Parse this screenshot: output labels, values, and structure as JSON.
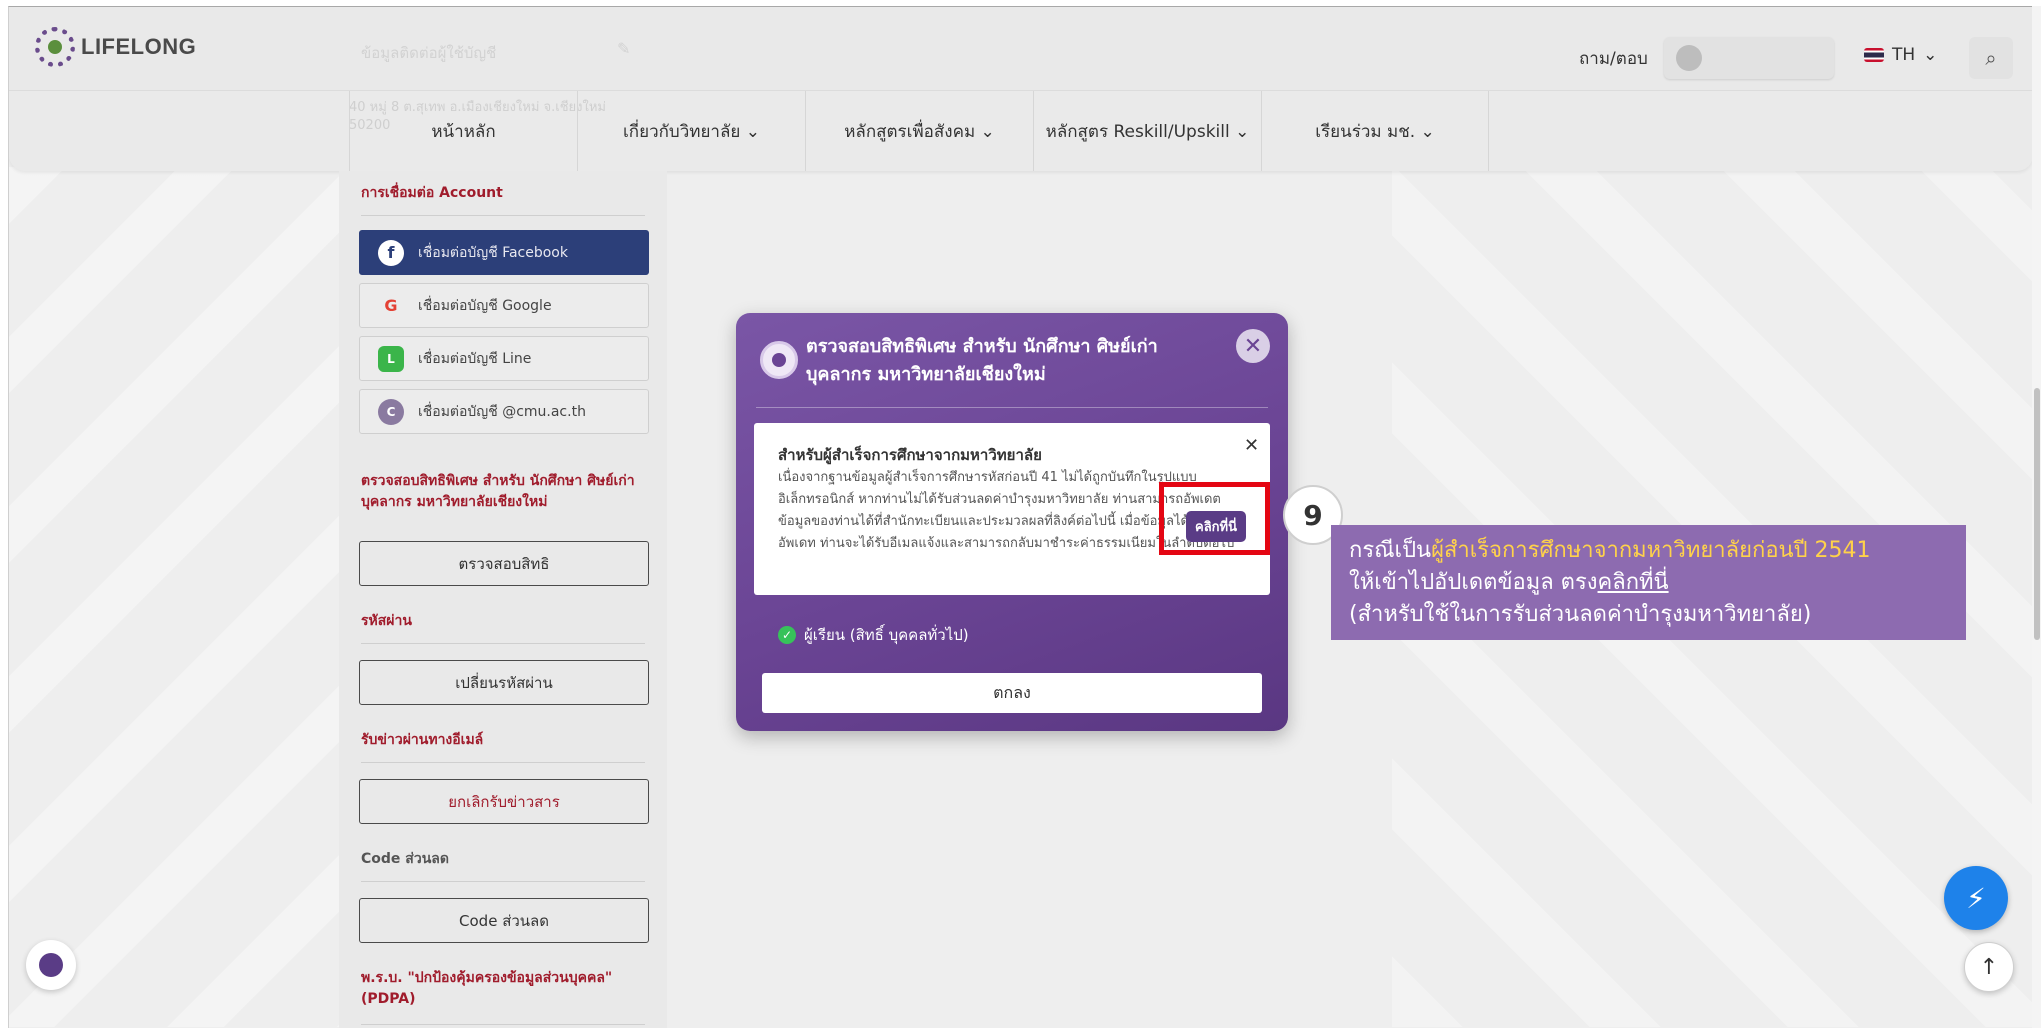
{
  "header": {
    "logo_text": "LIFELONG",
    "faint_text": "ข้อมูลติดต่อผู้ใช้บัญชี",
    "qa_link": "ถาม/ตอบ",
    "lang": "TH"
  },
  "nav": {
    "address": "40 หมู่ 8 ต.สุเทพ อ.เมืองเชียงใหม่ จ.เชียงใหม่ 50200",
    "items": [
      {
        "label": "หน้าหลัก"
      },
      {
        "label": "เกี่ยวกับวิทยาลัย ⌄"
      },
      {
        "label": "หลักสูตรเพื่อสังคม ⌄"
      },
      {
        "label": "หลักสูตร Reskill/Upskill ⌄"
      },
      {
        "label": "เรียนร่วม มช. ⌄"
      }
    ]
  },
  "sidebar": {
    "account_heading": "การเชื่อมต่อ Account",
    "social": [
      {
        "label": "เชื่อมต่อบัญชี Facebook",
        "icon": "f"
      },
      {
        "label": "เชื่อมต่อบัญชี Google",
        "icon": "G"
      },
      {
        "label": "เชื่อมต่อบัญชี Line",
        "icon": "L"
      },
      {
        "label": "เชื่อมต่อบัญชี @cmu.ac.th",
        "icon": "C"
      }
    ],
    "privilege_heading": "ตรวจสอบสิทธิพิเศษ สำหรับ นักศึกษา ศิษย์เก่า บุคลากร มหาวิทยาลัยเชียงใหม่",
    "privilege_button": "ตรวจสอบสิทธิ",
    "password_heading": "รหัสผ่าน",
    "password_button": "เปลี่ยนรหัสผ่าน",
    "email_heading": "รับข่าวผ่านทางอีเมล์",
    "email_button": "ยกเลิกรับข่าวสาร",
    "discount_heading": "Code ส่วนลด",
    "discount_button": "Code ส่วนลด",
    "pdpa_heading": "พ.ร.บ. \"ปกป้องคุ้มครองข้อมูลส่วนบุคคล\" (PDPA)"
  },
  "modal": {
    "title": "ตรวจสอบสิทธิพิเศษ สำหรับ นักศึกษา ศิษย์เก่า บุคลากร มหาวิทยาลัยเชียงใหม่",
    "notice_title": "สำหรับผู้สำเร็จการศึกษาจากมหาวิทยาลัย",
    "notice_body": "เนื่องจากฐานข้อมูลผู้สำเร็จการศึกษารหัสก่อนปี 41 ไม่ได้ถูกบันทึกในรูปแบบอิเล็กทรอนิกส์ หากท่านไม่ได้รับส่วนลดค่าบำรุงมหาวิทยาลัย ท่านสามารถอัพเดตข้อมูลของท่านได้ที่สำนักทะเบียนและประมวลผลที่ลิงค์ต่อไปนี้ เมื่อข้อมูลได้รับการอัพเดท ท่านจะได้รับอีเมลแจ้งและสามารถกลับมาชำระค่าธรรมเนียมในลำดับต่อไป",
    "click_here": "คลิกที่นี่",
    "role_label": "ผู้เรียน (สิทธิ์ บุคคลทั่วไป)",
    "ok_button": "ตกลง"
  },
  "annotation": {
    "step_number": "9",
    "line1_prefix": "กรณีเป็น",
    "line1_highlight": "ผู้สำเร็จการศึกษาจากมหาวิทยาลัยก่อนปี 2541",
    "line2_prefix": "ให้เข้าไปอัปเดตข้อมูล ตรง",
    "line2_link": "คลิกที่นี่",
    "line3": "(สำหรับใช้ในการรับส่วนลดค่าบำรุงมหาวิทยาลัย)",
    "highlight_color": "#ffd24a",
    "box_color": "#8d6bb0",
    "marker_color": "#e40613"
  }
}
